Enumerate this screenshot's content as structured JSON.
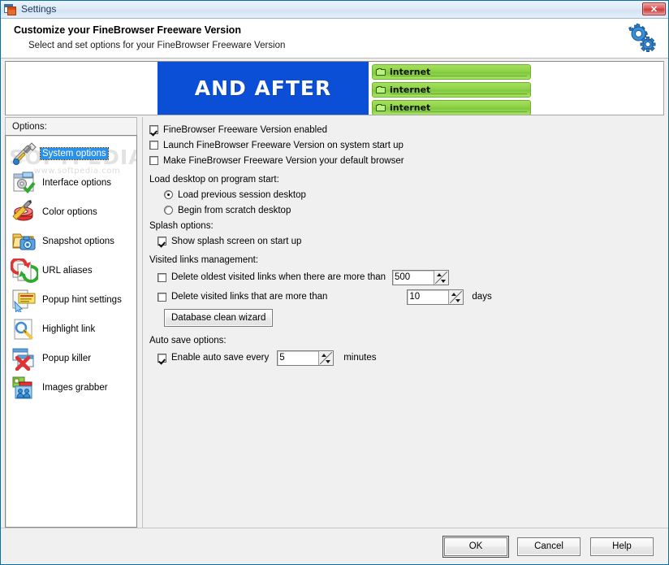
{
  "window": {
    "title": "Settings",
    "title_icon": "windows-stack-icon",
    "close_label": "✕"
  },
  "header": {
    "title": "Customize your FineBrowser Freeware Version",
    "subtitle": "Select and set options for your FineBrowser Freeware Version",
    "icon": "gears-icon"
  },
  "banner": {
    "blue_text": "AND AFTER",
    "green_rows": [
      {
        "label": "internet",
        "icon": "folder-icon"
      },
      {
        "label": "internet",
        "icon": "folder-icon"
      },
      {
        "label": "internet",
        "icon": "folder-icon"
      }
    ]
  },
  "sidebar": {
    "header": "Options:",
    "watermark_line1": "SOFTPEDIA",
    "watermark_line2": "www.softpedia.com",
    "items": [
      {
        "label": "System options",
        "icon": "hammer-screwdriver-icon",
        "selected": true
      },
      {
        "label": "Interface options",
        "icon": "window-gear-check-icon",
        "selected": false
      },
      {
        "label": "Color options",
        "icon": "paint-brush-icon",
        "selected": false
      },
      {
        "label": "Snapshot options",
        "icon": "camera-folder-icon",
        "selected": false
      },
      {
        "label": "URL aliases",
        "icon": "refresh-arrows-icon",
        "selected": false
      },
      {
        "label": "Popup hint settings",
        "icon": "popup-hint-icon",
        "selected": false
      },
      {
        "label": "Highlight link",
        "icon": "magnifier-icon",
        "selected": false
      },
      {
        "label": "Popup killer",
        "icon": "window-x-icon",
        "selected": false
      },
      {
        "label": "Images grabber",
        "icon": "images-grabber-icon",
        "selected": false
      }
    ]
  },
  "main": {
    "checkboxes": {
      "enabled": {
        "label": "FineBrowser Freeware Version enabled",
        "checked": true
      },
      "startup": {
        "label": "Launch FineBrowser Freeware Version on system start up",
        "checked": false
      },
      "default_browser": {
        "label": "Make FineBrowser Freeware Version your default browser",
        "checked": false
      }
    },
    "load_desktop": {
      "title": "Load desktop on program start:",
      "options": [
        {
          "label": "Load previous session desktop",
          "selected": true
        },
        {
          "label": "Begin from scratch desktop",
          "selected": false
        }
      ]
    },
    "splash": {
      "title": "Splash options:",
      "option": {
        "label": "Show splash screen on start up",
        "checked": true
      }
    },
    "visited_links": {
      "title": "Visited links management:",
      "delete_oldest": {
        "label": "Delete oldest visited links when there are more than",
        "checked": false,
        "value": "500"
      },
      "delete_older_than": {
        "label": "Delete visited links that are more than",
        "checked": false,
        "value": "10",
        "unit": "days"
      },
      "wizard_button": "Database clean wizard"
    },
    "auto_save": {
      "title": "Auto save options:",
      "label": "Enable auto save every",
      "checked": true,
      "value": "5",
      "unit": "minutes"
    }
  },
  "footer": {
    "ok": "OK",
    "cancel": "Cancel",
    "help": "Help"
  },
  "colors": {
    "selection_blue": "#2a90e8",
    "banner_blue": "#0b4fd6",
    "banner_green": "#8ed24a",
    "window_border": "#0b6fa4",
    "close_red": "#c63d3d"
  }
}
